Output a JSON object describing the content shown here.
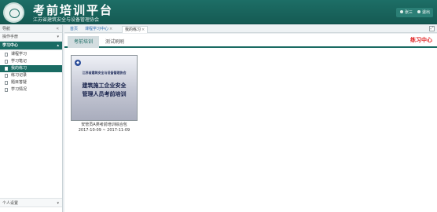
{
  "header": {
    "title": "考前培训平台",
    "subtitle": "江苏省建筑安全与设备管理协会",
    "user_label": "张三",
    "exit_label": "退出"
  },
  "sidebar": {
    "nav_title": "导航",
    "collapse_icon": "double-chevron-left-icon",
    "sections": {
      "manual": "操作手册",
      "learning": "学习中心",
      "personal": "个人设置"
    },
    "items": [
      {
        "label": "课程学习"
      },
      {
        "label": "学习笔记"
      },
      {
        "label": "我的练习"
      },
      {
        "label": "练习记录"
      },
      {
        "label": "题目答疑"
      },
      {
        "label": "学习情况"
      }
    ],
    "selected_index": 2
  },
  "top_tabs": [
    {
      "label": "首页"
    },
    {
      "label": "课程学习中心",
      "close": "×"
    },
    {
      "label": "我的练习",
      "close": "×"
    }
  ],
  "content": {
    "subtabs": [
      {
        "label": "考前培训"
      },
      {
        "label": "测试刷刷"
      }
    ],
    "section_title": "练习中心",
    "card": {
      "org": "江苏省建筑安全与设备管理协会",
      "title_line1": "建筑施工企业安全",
      "title_line2": "管理人员考前培训",
      "caption_line1": "安管员A类考前培训综合包",
      "caption_line2": "2017-10-09 ~ 2017-11-09"
    }
  },
  "colors": {
    "header_bg": "#1d6e66",
    "accent": "#1a6b63",
    "section_title": "#e02020",
    "tab_link": "#2a6bb0"
  }
}
